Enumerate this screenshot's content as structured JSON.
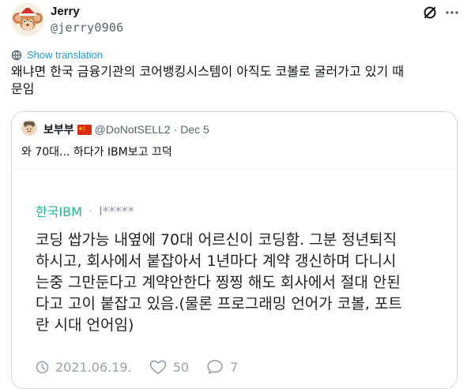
{
  "author": {
    "name": "Jerry",
    "handle": "@jerry0906"
  },
  "header": {
    "grok_icon": "grok-icon",
    "more_icon": "more-icon"
  },
  "translate": {
    "icon": "globe-icon",
    "label": "Show translation"
  },
  "tweet": {
    "text_line1": "왜냐면 한국 금융기관의 코어뱅킹시스템이 아직도 코볼로 굴러가고 있기 때",
    "text_line2": "문임"
  },
  "quote": {
    "name": "보부부",
    "flag": "china-flag-icon",
    "handle": "@DoNotSELL2",
    "dot": "·",
    "date": "Dec 5",
    "text": "와 70대... 하다가 IBM보고 끄덕",
    "embedded_post": {
      "company": "한국IBM",
      "separator": "·",
      "user": "I*****",
      "body_lines": [
        "코딩 쌉가능 내옆에 70대 어르신이 코딩함. 그분 정년퇴직",
        "하시고, 회사에서 붙잡아서 1년마다 계약 갱신하며 다니시",
        "는중 그만둔다고 계약안한다 찡찡 해도 회사에서 절대 안된",
        "다고 고이 붙잡고 있음.(물론 프로그래밍 언어가 코볼, 포트",
        "란 시대 언어임)"
      ],
      "date": "2021.06.19.",
      "likes": "50",
      "comments": "7"
    }
  },
  "colors": {
    "link": "#1d9bf0",
    "company": "#1ebb8e",
    "muted": "#536471",
    "border": "#cfd9de"
  }
}
